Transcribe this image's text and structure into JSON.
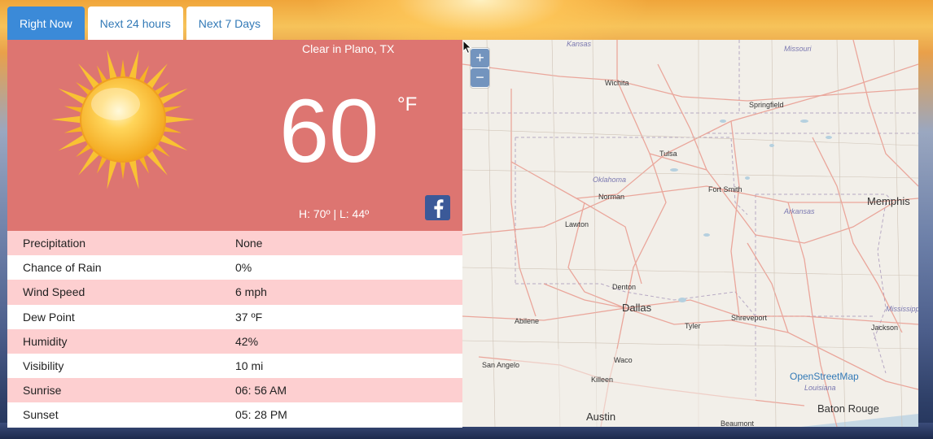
{
  "tabs": [
    {
      "label": "Right Now",
      "active": true
    },
    {
      "label": "Next 24 hours",
      "active": false
    },
    {
      "label": "Next 7 Days",
      "active": false
    }
  ],
  "current": {
    "condition": "Clear in Plano, TX",
    "temperature": "60",
    "unit": "°F",
    "hilo": "H: 70º | L: 44º",
    "weather_icon": "sun-icon",
    "share_icon": "facebook-icon"
  },
  "details": [
    {
      "label": "Precipitation",
      "value": "None"
    },
    {
      "label": "Chance of Rain",
      "value": "0%"
    },
    {
      "label": "Wind Speed",
      "value": "6 mph"
    },
    {
      "label": "Dew Point",
      "value": "37 ºF"
    },
    {
      "label": "Humidity",
      "value": "42%"
    },
    {
      "label": "Visibility",
      "value": "10 mi"
    },
    {
      "label": "Sunrise",
      "value": "06: 56 AM"
    },
    {
      "label": "Sunset",
      "value": "05: 28 PM"
    }
  ],
  "map": {
    "zoom_in": "+",
    "zoom_out": "−",
    "attribution": "OpenStreetMap",
    "cities": [
      "Wichita",
      "Springfield",
      "Tulsa",
      "Norman",
      "Fort Smith",
      "Memphis",
      "Lawton",
      "Denton",
      "Dallas",
      "Abilene",
      "Tyler",
      "Shreveport",
      "Jackson",
      "San Angelo",
      "Waco",
      "Killeen",
      "Austin",
      "Baton Rouge",
      "Beaumont"
    ],
    "states": [
      "Kansas",
      "Missouri",
      "Oklahoma",
      "Arkansas",
      "Mississippi",
      "Louisiana"
    ]
  },
  "colors": {
    "current_bg": "#dd7571",
    "row_odd": "#fdcfd0",
    "tab_active": "#3b8ad8",
    "link": "#337ab7"
  }
}
